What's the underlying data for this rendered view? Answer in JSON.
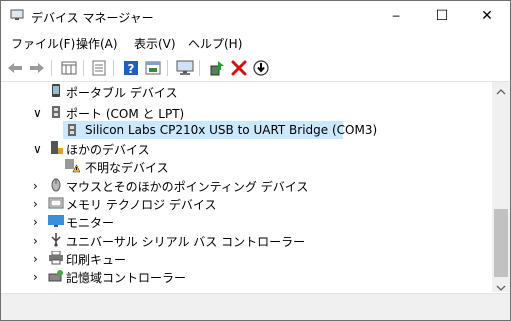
{
  "window": {
    "title": "デバイス マネージャー",
    "controls": {
      "minimize": "─",
      "maximize": "☐",
      "close": "✕"
    }
  },
  "menu": [
    {
      "label": "ファイル(F)"
    },
    {
      "label": "操作(A)"
    },
    {
      "label": "表示(V)"
    },
    {
      "label": "ヘルプ(H)"
    }
  ],
  "toolbar": {
    "icons": [
      "back-arrow-icon",
      "forward-arrow-icon",
      "properties-grid-icon",
      "list-view-icon",
      "help-icon",
      "action-icon",
      "monitor-icon",
      "update-driver-icon",
      "uninstall-x-icon",
      "download-icon"
    ]
  },
  "tree": {
    "items": [
      {
        "label": "ポータブル デバイス",
        "expander": "",
        "level": 0
      },
      {
        "label": "ポート (COM と LPT)",
        "expander": "∨",
        "level": 0
      },
      {
        "label": "Silicon Labs CP210x USB to UART Bridge (COM3)",
        "expander": "",
        "level": 1,
        "selected": true
      },
      {
        "label": "ほかのデバイス",
        "expander": "∨",
        "level": 0
      },
      {
        "label": "不明なデバイス",
        "expander": "",
        "level": 1
      },
      {
        "label": "マウスとそのほかのポインティング デバイス",
        "expander": "›",
        "level": 0
      },
      {
        "label": "メモリ テクノロジ デバイス",
        "expander": "›",
        "level": 0
      },
      {
        "label": "モニター",
        "expander": "›",
        "level": 0
      },
      {
        "label": "ユニバーサル シリアル バス コントローラー",
        "expander": "›",
        "level": 0
      },
      {
        "label": "印刷キュー",
        "expander": "›",
        "level": 0
      },
      {
        "label": "記憶域コントローラー",
        "expander": "›",
        "level": 0
      }
    ]
  },
  "colors": {
    "selection": "#cce8ff",
    "close_red": "#e81123",
    "help_blue": "#1f5fbf"
  }
}
